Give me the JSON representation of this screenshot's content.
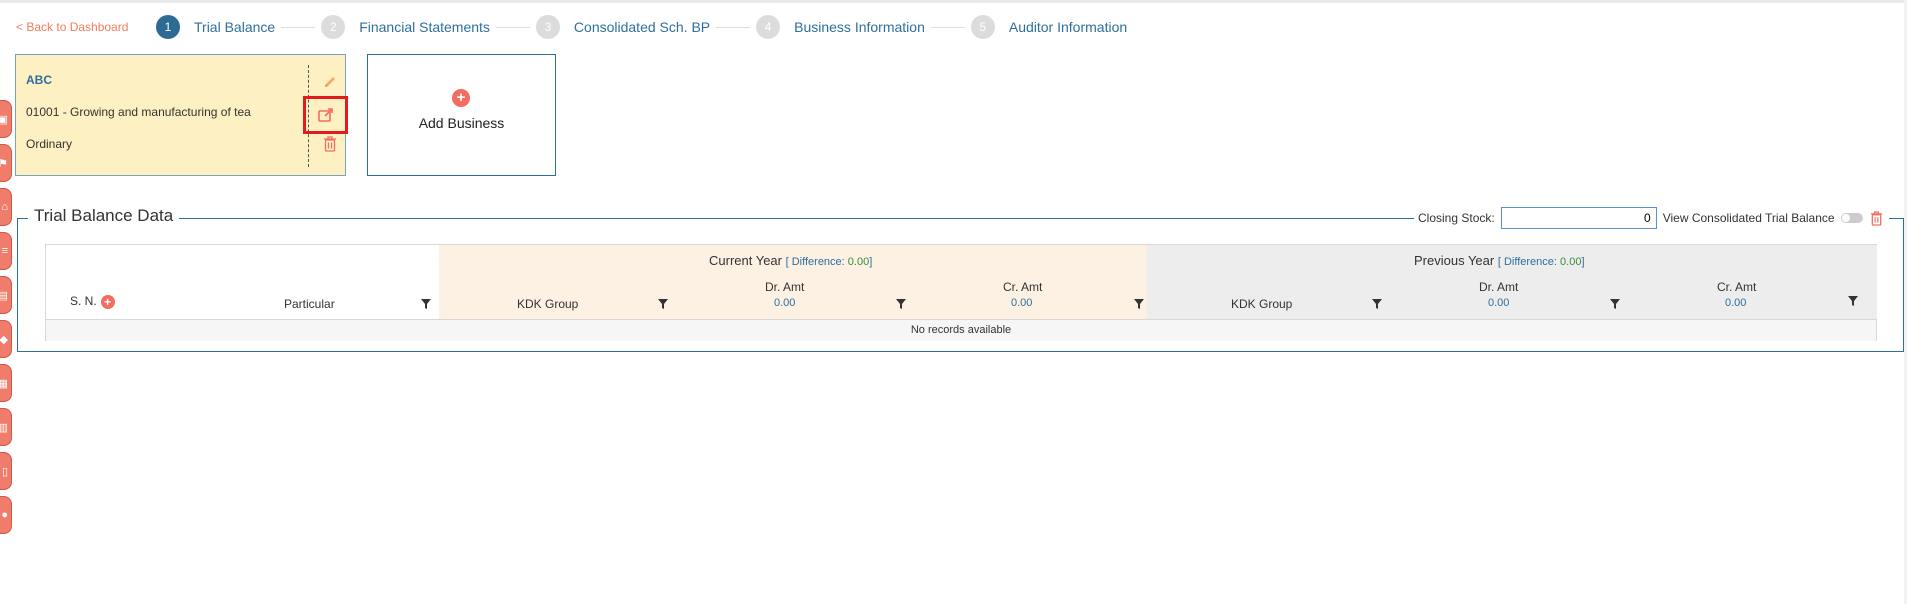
{
  "nav": {
    "back_label": "< Back to Dashboard",
    "steps": [
      {
        "num": "1",
        "label": "Trial Balance"
      },
      {
        "num": "2",
        "label": "Financial Statements"
      },
      {
        "num": "3",
        "label": "Consolidated Sch. BP"
      },
      {
        "num": "4",
        "label": "Business Information"
      },
      {
        "num": "5",
        "label": "Auditor Information"
      }
    ],
    "active_step": 1
  },
  "business_card": {
    "name": "ABC",
    "code_description": "01001 - Growing and manufacturing of tea",
    "type": "Ordinary",
    "actions": [
      "edit-icon",
      "export-icon",
      "delete-icon"
    ]
  },
  "add_business": {
    "label": "Add Business"
  },
  "trial_balance": {
    "title": "Trial Balance Data",
    "closing_stock_label": "Closing Stock:",
    "closing_stock_value": "0",
    "view_consolidated_label": "View Consolidated Trial Balance",
    "current_year": {
      "title": "Current Year",
      "difference_prefix": "[ Difference: ",
      "difference_value": "0.00",
      "difference_suffix": "]"
    },
    "previous_year": {
      "title": "Previous Year",
      "difference_prefix": "[ Difference: ",
      "difference_value": "0.00",
      "difference_suffix": "]"
    },
    "columns": {
      "sn": "S. N.",
      "particular": "Particular",
      "kdk_group": "KDK Group",
      "dr_amt": "Dr. Amt",
      "cr_amt": "Cr. Amt"
    },
    "totals": {
      "cy_dr": "0.00",
      "cy_cr": "0.00",
      "py_dr": "0.00",
      "py_cr": "0.00"
    },
    "empty_message": "No records available"
  },
  "colors": {
    "primary": "#2e6f9e",
    "accent": "#f07c5d",
    "card_bg": "#fdf0c3",
    "highlight": "#e21c1c"
  }
}
